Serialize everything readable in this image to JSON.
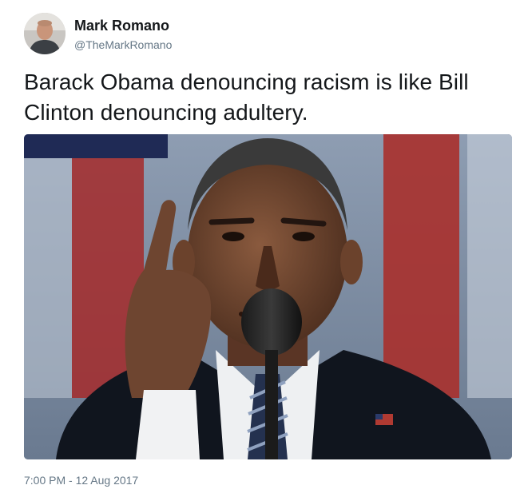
{
  "tweet": {
    "author": {
      "name": "Mark Romano",
      "handle": "@TheMarkRomano",
      "avatar_icon": "user-avatar"
    },
    "text": "Barack Obama denouncing racism is like Bill Clinton denouncing adultery.",
    "media": {
      "kind": "photo",
      "image_icon": "speaker-pointing-photo"
    },
    "timestamp": "7:00 PM - 12 Aug 2017"
  },
  "colors": {
    "primary_text": "#14171a",
    "secondary_text": "#657786",
    "background": "#ffffff"
  }
}
